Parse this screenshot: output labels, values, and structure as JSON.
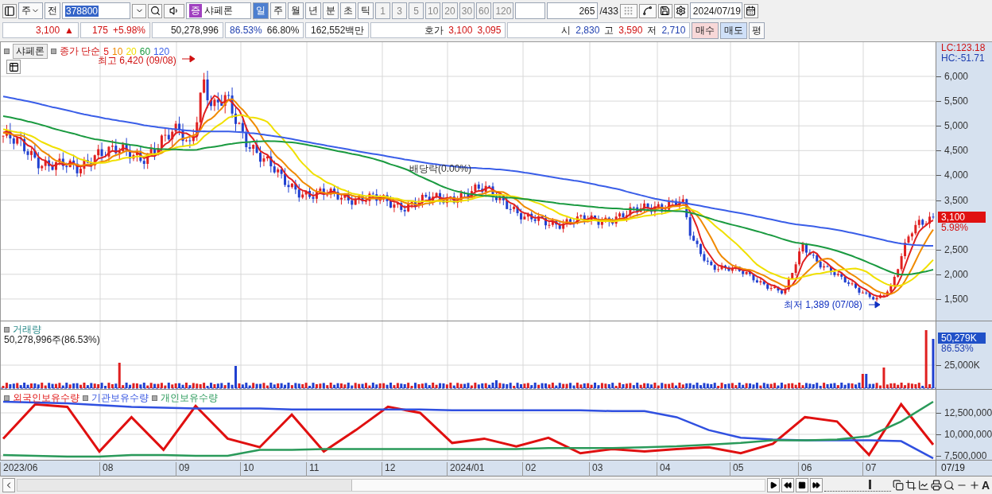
{
  "toolbar": {
    "market": "주",
    "prev": "전",
    "code": "378800",
    "badge": "증",
    "name": "샤페론",
    "periods": [
      {
        "label": "일",
        "selected": true
      },
      {
        "label": "주",
        "selected": false
      },
      {
        "label": "월",
        "selected": false
      },
      {
        "label": "년",
        "selected": false
      },
      {
        "label": "분",
        "selected": false
      },
      {
        "label": "초",
        "selected": false
      },
      {
        "label": "틱",
        "selected": false
      }
    ],
    "intervals": [
      "1",
      "3",
      "5",
      "10",
      "20",
      "30",
      "60",
      "120"
    ],
    "count": "265",
    "total": "/433",
    "date": "2024/07/19"
  },
  "quote": {
    "price": "3,100",
    "arrow": "▲",
    "change": "175",
    "rate": "+5.98%",
    "volume": "50,278,996",
    "volume_ratio": "86.53%",
    "turnover": "66.80%",
    "amount": "162,552백만",
    "ask_label": "호가",
    "ask": "3,100",
    "bid": "3,095",
    "open_label": "시",
    "open": "2,830",
    "high_label": "고",
    "high": "3,590",
    "low_label": "저",
    "low": "2,710",
    "buy": "매수",
    "sell": "매도",
    "avg": "평"
  },
  "price_pane": {
    "name": "샤페론",
    "ma_title": "종가 단순",
    "averages": [
      {
        "label": "5",
        "color": "#e02020"
      },
      {
        "label": "10",
        "color": "#f08a00"
      },
      {
        "label": "20",
        "color": "#f0e000"
      },
      {
        "label": "60",
        "color": "#1a9a40"
      },
      {
        "label": "120",
        "color": "#3a5ee8"
      }
    ],
    "high_note": "최고 6,420 (09/08)",
    "dividend_note": "배당락(0.00%)",
    "low_note": "최저 1,389 (07/08)",
    "lc": "LC:123.18",
    "hc": "HC:-51.71",
    "ticks": [
      "6,000",
      "5,500",
      "5,000",
      "4,500",
      "4,000",
      "3,500",
      "2,500",
      "2,000",
      "1,500"
    ],
    "current": "3,100",
    "current_rate": "5.98%"
  },
  "volume_pane": {
    "title": "거래량",
    "summary": "50,278,996주(86.53%)",
    "current": "50,279K",
    "current_rate": "86.53%",
    "tick": "25,000K"
  },
  "holdings_pane": {
    "chart_data": {
      "type": "line",
      "grid": true,
      "ylim": [
        6944000,
        15185000
      ],
      "yticks": [
        {
          "value": 12500000,
          "label": "12,500,000"
        },
        {
          "value": 10000000,
          "label": "10,000,000"
        },
        {
          "value": 7500000,
          "label": "7,500,000"
        }
      ],
      "series": [
        {
          "name": "외국인보유수량",
          "color": "#e01010",
          "values": [
            9500000,
            13500000,
            13200000,
            8000000,
            12000000,
            8200000,
            13300000,
            9500000,
            8500000,
            12300000,
            8000000,
            10500000,
            13200000,
            12500000,
            9000000,
            9500000,
            8600000,
            9600000,
            7800000,
            8300000,
            8000000,
            8300000,
            8500000,
            7800000,
            8900000,
            12000000,
            11500000,
            7600000,
            13500000,
            8800000
          ]
        },
        {
          "name": "기관보유수량",
          "color": "#3050e0",
          "values": [
            13800000,
            13700000,
            13600000,
            13400000,
            13200000,
            13100000,
            13000000,
            13000000,
            13000000,
            12900000,
            12900000,
            12900000,
            12900000,
            12900000,
            12800000,
            12800000,
            12800000,
            12800000,
            12800000,
            12700000,
            12700000,
            12000000,
            10500000,
            9600000,
            9400000,
            9300000,
            9300000,
            9300000,
            9200000,
            7200000
          ]
        },
        {
          "name": "개인보유수량",
          "color": "#2a9a5a",
          "values": [
            7600000,
            7500000,
            7400000,
            7400000,
            7600000,
            7600000,
            7500000,
            7500000,
            8200000,
            8200000,
            8300000,
            8300000,
            8300000,
            8300000,
            8300000,
            8300000,
            8300000,
            8400000,
            8400000,
            8400000,
            8500000,
            8600000,
            8800000,
            9000000,
            9300000,
            9300000,
            9400000,
            9800000,
            11500000,
            13800000
          ]
        }
      ]
    }
  },
  "x_axis": {
    "labels": [
      "2023/06",
      "08",
      "09",
      "10",
      "11",
      "12",
      "2024/01",
      "02",
      "03",
      "04",
      "05",
      "06",
      "07"
    ],
    "end": "07/19"
  },
  "bottom_bar": {
    "level": 0.7,
    "font_button": "A"
  }
}
